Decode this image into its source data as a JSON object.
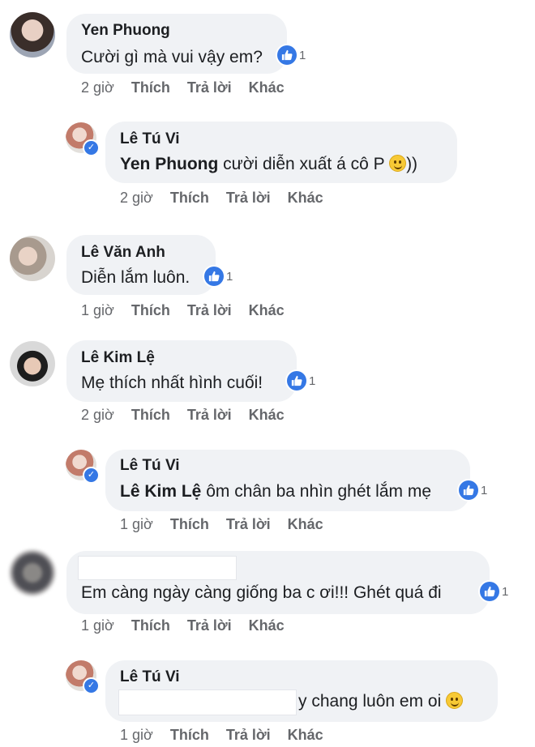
{
  "comments": [
    {
      "name": "Yen Phuong",
      "text": "Cười gì mà vui vậy em?",
      "likes": "1",
      "time": "2 giờ",
      "like_action": "Thích",
      "reply_action": "Trả lời",
      "more_action": "Khác"
    },
    {
      "name": "Lê Tú Vi",
      "mention": "Yen Phuong",
      "text": " cười diễn xuất á cô P ",
      "suffix": "))",
      "time": "2 giờ",
      "like_action": "Thích",
      "reply_action": "Trả lời",
      "more_action": "Khác"
    },
    {
      "name": "Lê Văn Anh",
      "text": "Diễn lắm luôn.",
      "likes": "1",
      "time": "1 giờ",
      "like_action": "Thích",
      "reply_action": "Trả lời",
      "more_action": "Khác"
    },
    {
      "name": "Lê Kim Lệ",
      "text": "Mẹ thích nhất hình cuối!",
      "likes": "1",
      "time": "2 giờ",
      "like_action": "Thích",
      "reply_action": "Trả lời",
      "more_action": "Khác"
    },
    {
      "name": "Lê Tú Vi",
      "mention": "Lê Kim Lệ",
      "text": " ôm chân ba nhìn ghét lắm mẹ",
      "likes": "1",
      "time": "1 giờ",
      "like_action": "Thích",
      "reply_action": "Trả lời",
      "more_action": "Khác"
    },
    {
      "text": "Em càng ngày càng giống ba c ơi!!! Ghét quá đi",
      "likes": "1",
      "time": "1 giờ",
      "like_action": "Thích",
      "reply_action": "Trả lời",
      "more_action": "Khác"
    },
    {
      "name": "Lê Tú Vi",
      "text": "y chang luôn em oi ",
      "time": "1 giờ",
      "like_action": "Thích",
      "reply_action": "Trả lời",
      "more_action": "Khác"
    }
  ],
  "colors": {
    "accent": "#3578e5",
    "bubble": "#f0f2f5",
    "meta": "#65676b"
  },
  "icons": {
    "like": "thumbs-up-icon",
    "verified": "check-icon",
    "emoji": "smiley-icon"
  }
}
